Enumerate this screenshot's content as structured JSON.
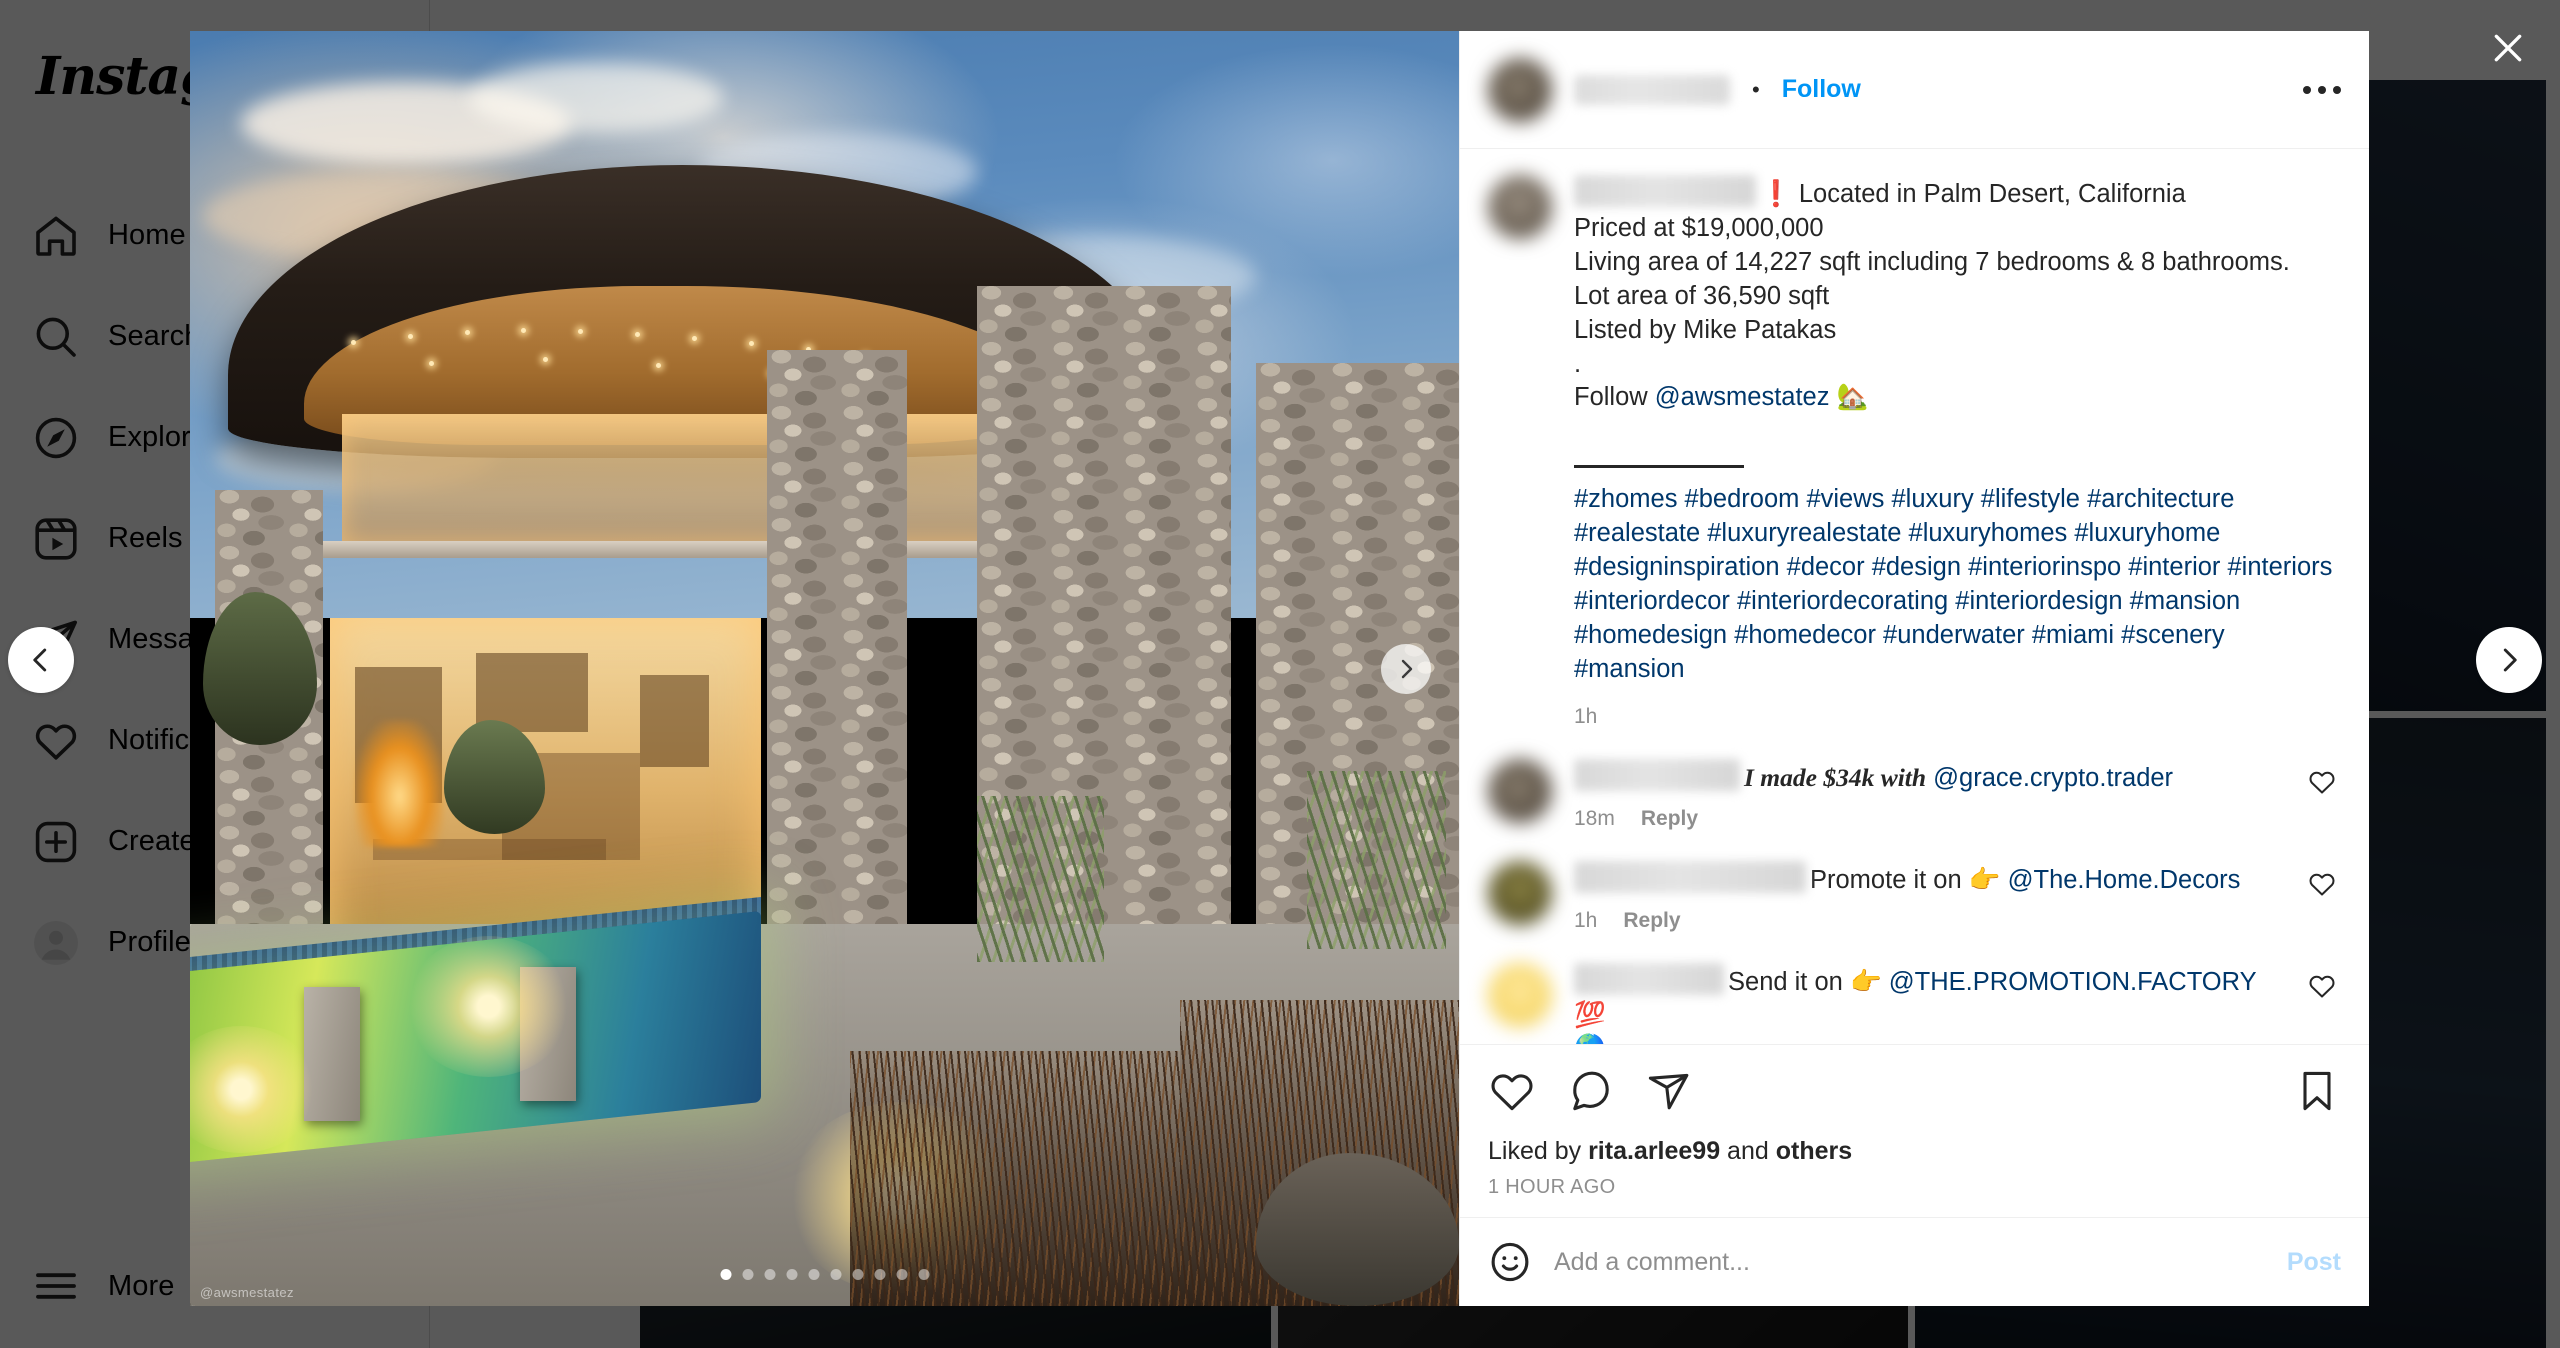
{
  "sidebar": {
    "logo": "Instagram",
    "items": [
      {
        "label": "Home",
        "icon": "home-icon"
      },
      {
        "label": "Search",
        "icon": "search-icon"
      },
      {
        "label": "Explore",
        "icon": "compass-icon"
      },
      {
        "label": "Reels",
        "icon": "reels-icon"
      },
      {
        "label": "Messages",
        "icon": "paper-plane-icon"
      },
      {
        "label": "Notifications",
        "icon": "heart-icon"
      },
      {
        "label": "Create",
        "icon": "plus-square-icon"
      },
      {
        "label": "Profile",
        "icon": "avatar-icon"
      }
    ],
    "more_label": "More"
  },
  "post": {
    "header": {
      "username": "",
      "separator": "•",
      "follow_label": "Follow",
      "options_icon": "kebab-menu-icon"
    },
    "caption": {
      "username": "",
      "lines": [
        "❗ Located in Palm Desert, California",
        "Priced at $19,000,000",
        "Living area of 14,227 sqft including 7 bedrooms & 8 bathrooms.",
        "Lot area of 36,590 sqft",
        "Listed by Mike Patakas",
        ".",
        "Follow @awsmestatez 🏡"
      ],
      "follow_prefix": "Follow ",
      "follow_mention": "@awsmestatez",
      "follow_emoji": "🏡",
      "hashtags": "#zhomes #bedroom #views #luxury #lifestyle #architecture #realestate #luxuryrealestate #luxuryhomes #luxuryhome #designinspiration #decor #design #interiorinspo #interior #interiors #interiordecor #interiordecorating #interiordesign #mansion #homedesign #homedecor #underwater #miami #scenery #mansion",
      "time": "1h"
    },
    "comments": [
      {
        "username": "",
        "text_italic": "I made $34k with",
        "mention": "@grace.crypto.trader",
        "emoji": "",
        "time": "18m",
        "reply_label": "Reply",
        "avatar": "av-blur"
      },
      {
        "username": "",
        "text": "Promote it on",
        "emoji": "👉",
        "mention": "@The.Home.Decors",
        "time": "1h",
        "reply_label": "Reply",
        "avatar": "av-olive"
      },
      {
        "username": "",
        "text": "Send it on",
        "emoji": "👉",
        "mention": "@THE.PROMOTION.FACTORY",
        "emoji_end": "💯",
        "emoji_next_line": "🌎",
        "time": "",
        "reply_label": "",
        "avatar": "av-yellow"
      }
    ],
    "actions": {
      "like_icon": "heart-icon",
      "comment_icon": "speech-bubble-icon",
      "share_icon": "paper-plane-icon",
      "save_icon": "bookmark-icon"
    },
    "likes": {
      "prefix": "Liked by ",
      "user": "rita.arlee99",
      "middle": " and ",
      "suffix": "others"
    },
    "posted_time": "1 HOUR AGO",
    "add_comment": {
      "emoji_icon": "emoji-smiley-icon",
      "placeholder": "Add a comment...",
      "value": "",
      "post_label": "Post"
    },
    "carousel": {
      "total_dots": 10,
      "active_index": 0,
      "next_icon": "chevron-right-icon"
    },
    "photo_credit": "@awsmestatez"
  },
  "overlay": {
    "prev_icon": "chevron-left-icon",
    "next_icon": "chevron-right-icon",
    "close_icon": "close-icon"
  },
  "colors": {
    "link_blue": "#0095f6",
    "mention_blue": "#00376b",
    "muted_gray": "#8e8e8e",
    "text": "#262626",
    "post_disabled": "#b3dcfd"
  }
}
